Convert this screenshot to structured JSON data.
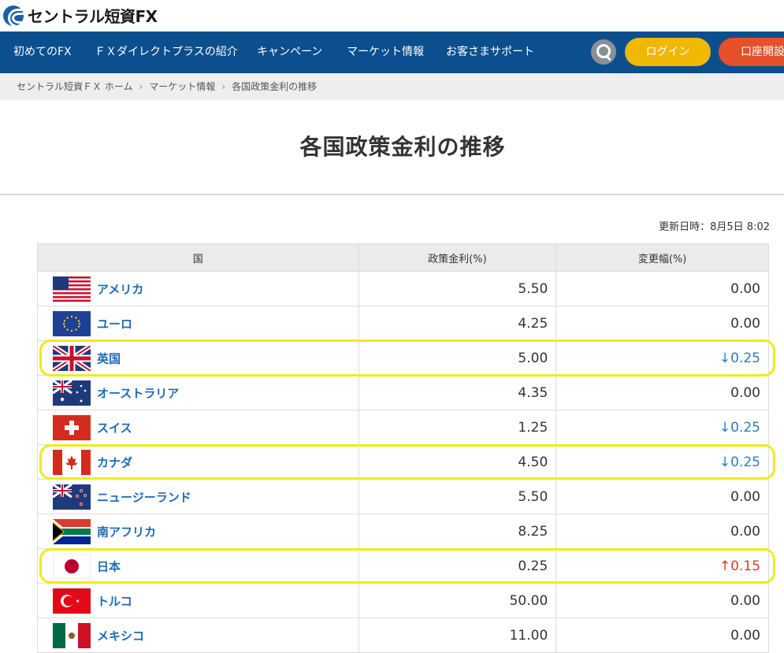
{
  "header": {
    "logo_text": "セントラル短資FX",
    "nav": [
      "初めてのFX",
      "ＦＸダイレクトプラスの紹介",
      "キャンペーン",
      "マーケット情報",
      "お客さまサポート"
    ],
    "login_label": "ログイン",
    "open_account_label": "口座開設"
  },
  "breadcrumb": [
    "セントラル短資ＦＸ ホーム",
    "マーケット情報",
    "各国政策金利の推移"
  ],
  "page_title": "各国政策金利の推移",
  "updated": "更新日時：8月5日 8:02",
  "table": {
    "headers": [
      "国",
      "政策金利(%)",
      "変更幅(%)"
    ],
    "rows": [
      {
        "name": "アメリカ",
        "flag": "us-flag-icon",
        "rate": "5.50",
        "change": "0.00",
        "dir": "none"
      },
      {
        "name": "ユーロ",
        "flag": "eu-flag-icon",
        "rate": "4.25",
        "change": "0.00",
        "dir": "none"
      },
      {
        "name": "英国",
        "flag": "uk-flag-icon",
        "rate": "5.00",
        "change": "↓0.25",
        "dir": "down"
      },
      {
        "name": "オーストラリア",
        "flag": "australia-flag-icon",
        "rate": "4.35",
        "change": "0.00",
        "dir": "none"
      },
      {
        "name": "スイス",
        "flag": "switzerland-flag-icon",
        "rate": "1.25",
        "change": "↓0.25",
        "dir": "down"
      },
      {
        "name": "カナダ",
        "flag": "canada-flag-icon",
        "rate": "4.50",
        "change": "↓0.25",
        "dir": "down"
      },
      {
        "name": "ニュージーランド",
        "flag": "new-zealand-flag-icon",
        "rate": "5.50",
        "change": "0.00",
        "dir": "none"
      },
      {
        "name": "南アフリカ",
        "flag": "south-africa-flag-icon",
        "rate": "8.25",
        "change": "0.00",
        "dir": "none"
      },
      {
        "name": "日本",
        "flag": "japan-flag-icon",
        "rate": "0.25",
        "change": "↑0.15",
        "dir": "up"
      },
      {
        "name": "トルコ",
        "flag": "turkey-flag-icon",
        "rate": "50.00",
        "change": "0.00",
        "dir": "none"
      },
      {
        "name": "メキシコ",
        "flag": "mexico-flag-icon",
        "rate": "11.00",
        "change": "0.00",
        "dir": "none"
      }
    ]
  },
  "highlighted_rows": [
    "英国",
    "カナダ",
    "日本"
  ],
  "colors": {
    "nav_bg": "#0b4f8e",
    "login": "#f0b800",
    "open_account": "#e6502a",
    "rate_down": "#2b7bc4",
    "rate_up": "#e03a2a",
    "highlight": "#f2ea1a"
  }
}
